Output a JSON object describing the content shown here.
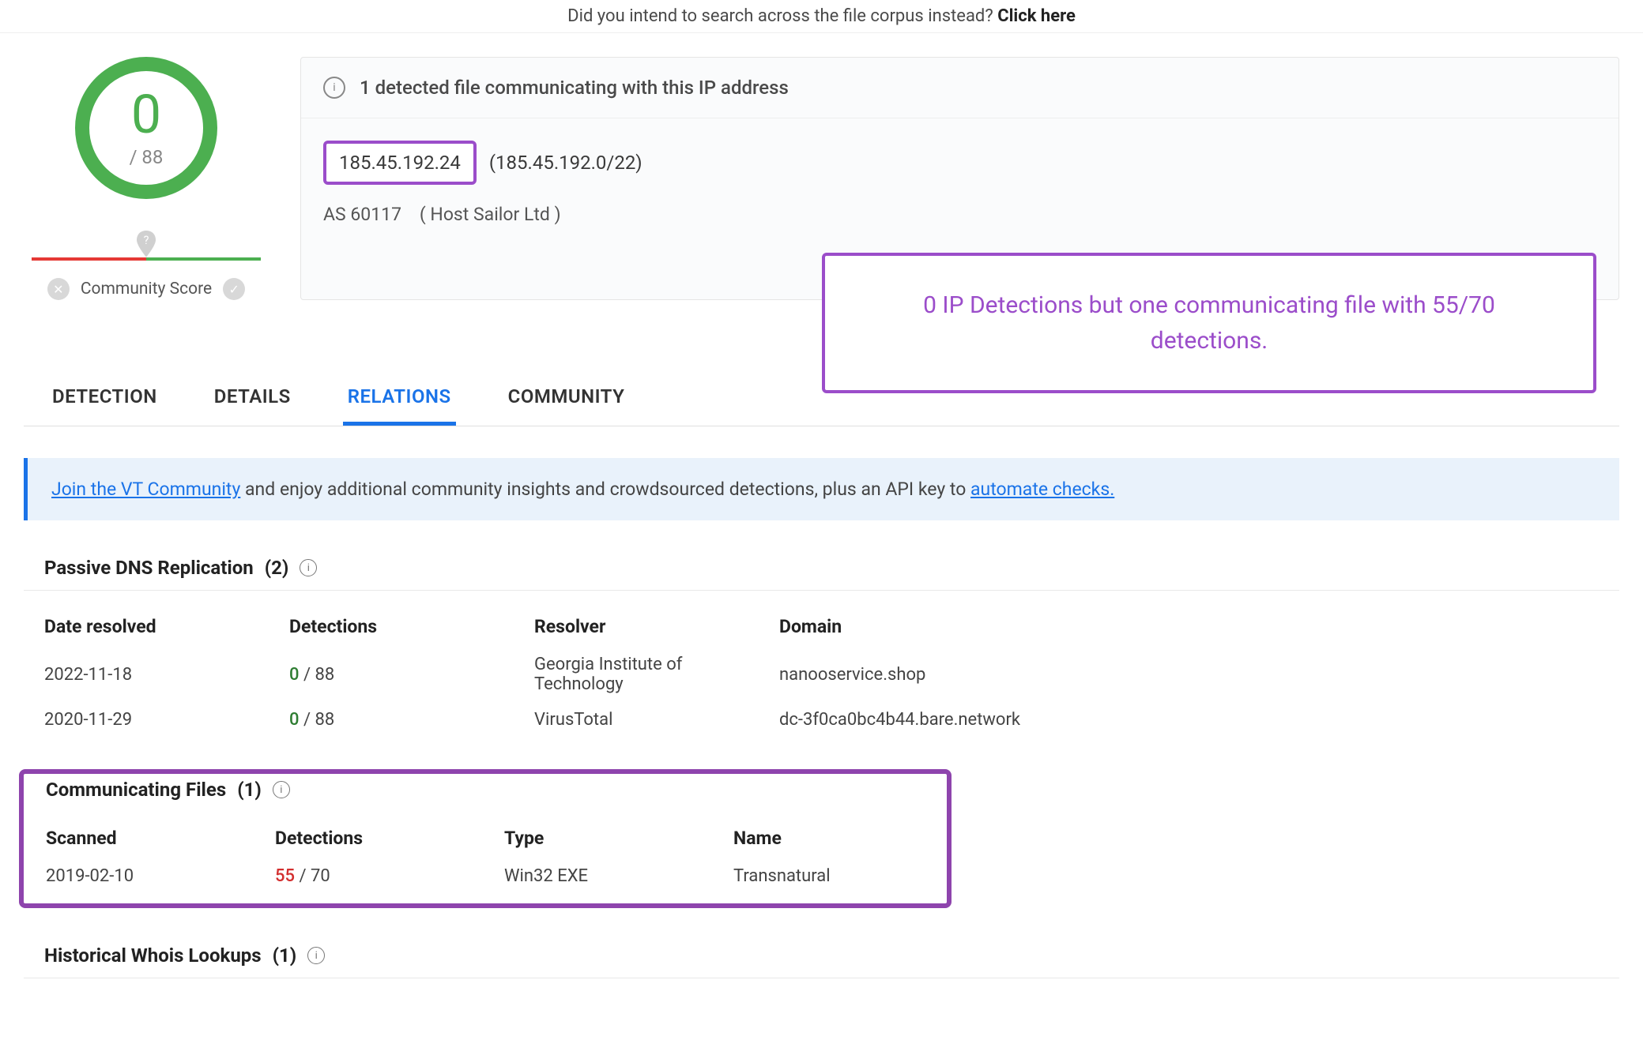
{
  "top_banner": {
    "text": "Did you intend to search across the file corpus instead? ",
    "link": "Click here"
  },
  "score": {
    "numerator": "0",
    "denominator": "/ 88"
  },
  "community": {
    "label": "Community Score"
  },
  "info_alert": "1 detected file communicating with this IP address",
  "ip": {
    "address": "185.45.192.24",
    "cidr": "(185.45.192.0/22)",
    "asn": "AS 60117",
    "org": "( Host Sailor Ltd )"
  },
  "annotation": "0 IP Detections but one communicating file with 55/70 detections.",
  "tabs": [
    "DETECTION",
    "DETAILS",
    "RELATIONS",
    "COMMUNITY"
  ],
  "active_tab": "RELATIONS",
  "promo": {
    "join": "Join the VT Community",
    "middle": " and enjoy additional community insights and crowdsourced detections, plus an API key to ",
    "automate": "automate checks."
  },
  "dns_section": {
    "title": "Passive DNS Replication",
    "count": "(2)",
    "headers": [
      "Date resolved",
      "Detections",
      "Resolver",
      "Domain"
    ],
    "rows": [
      {
        "date": "2022-11-18",
        "det_num": "0",
        "det_den": " / 88",
        "resolver": "Georgia Institute of Technology",
        "domain": "nanooservice.shop"
      },
      {
        "date": "2020-11-29",
        "det_num": "0",
        "det_den": " / 88",
        "resolver": "VirusTotal",
        "domain": "dc-3f0ca0bc4b44.bare.network"
      }
    ]
  },
  "comm_section": {
    "title": "Communicating Files",
    "count": "(1)",
    "headers": [
      "Scanned",
      "Detections",
      "Type",
      "Name"
    ],
    "rows": [
      {
        "scanned": "2019-02-10",
        "det_num": "55",
        "det_den": " / 70",
        "type": "Win32 EXE",
        "name": "Transnatural"
      }
    ]
  },
  "whois_section": {
    "title": "Historical Whois Lookups",
    "count": "(1)"
  }
}
